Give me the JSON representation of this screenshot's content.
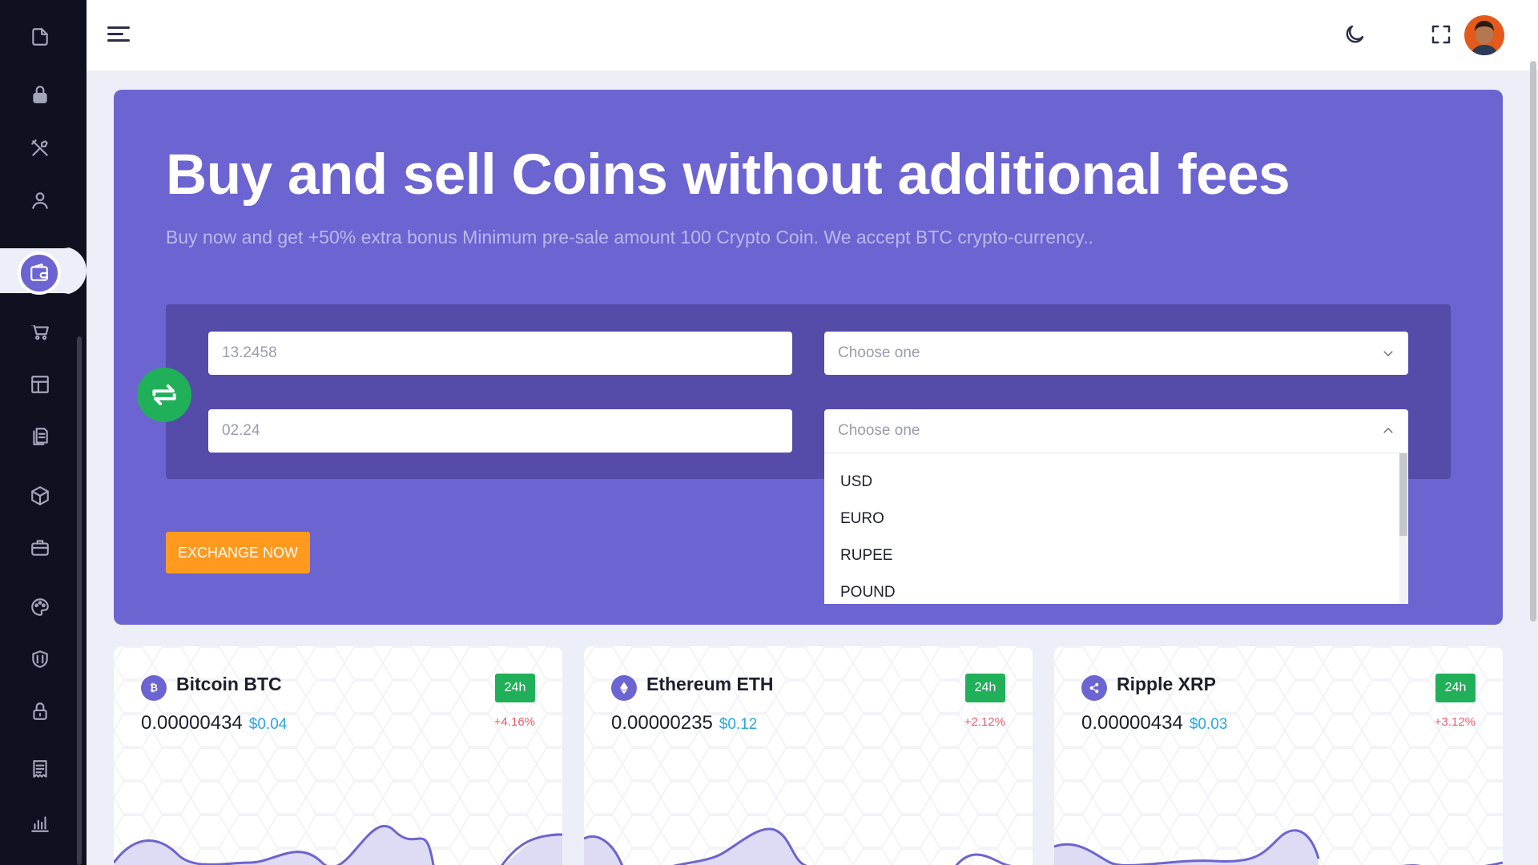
{
  "header": {
    "avatar_alt": "User avatar"
  },
  "hero": {
    "title": "Buy and sell Coins without additional fees",
    "subtitle": "Buy now and get +50% extra bonus Minimum pre-sale amount 100 Crypto Coin. We accept BTC crypto-currency..",
    "amount_1": "13.2458",
    "amount_2": "02.24",
    "select_1_placeholder": "Choose one",
    "select_2_placeholder": "Choose one",
    "exchange_button": "EXCHANGE NOW",
    "dropdown_options": [
      "USD",
      "EURO",
      "RUPEE",
      "POUND"
    ]
  },
  "cards": [
    {
      "name": "Bitcoin BTC",
      "value": "0.00000434",
      "usd": "$0.04",
      "badge": "24h",
      "change": "+4.16%",
      "icon": "bitcoin-icon"
    },
    {
      "name": "Ethereum ETH",
      "value": "0.00000235",
      "usd": "$0.12",
      "badge": "24h",
      "change": "+2.12%",
      "icon": "ethereum-icon"
    },
    {
      "name": "Ripple XRP",
      "value": "0.00000434",
      "usd": "$0.03",
      "badge": "24h",
      "change": "+3.12%",
      "icon": "ripple-icon"
    }
  ],
  "colors": {
    "accent": "#6c64d0",
    "exchange_box": "#554ca9",
    "button": "#ff9a1f",
    "badge": "#21b05a",
    "change": "#ee5a6a",
    "usd": "#2aa5df"
  }
}
